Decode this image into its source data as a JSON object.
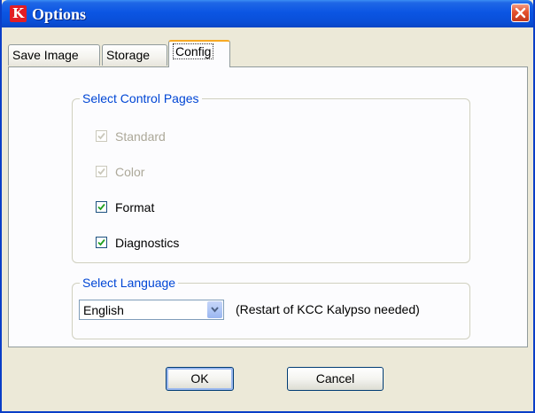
{
  "window": {
    "title": "Options",
    "app_icon_letter": "K",
    "close_glyph": "×"
  },
  "tabs": [
    {
      "label": "Save Image",
      "active": false
    },
    {
      "label": "Storage",
      "active": false
    },
    {
      "label": "Config",
      "active": true
    }
  ],
  "control_pages": {
    "legend": "Select Control Pages",
    "items": [
      {
        "label": "Standard",
        "checked": true,
        "enabled": false
      },
      {
        "label": "Color",
        "checked": true,
        "enabled": false
      },
      {
        "label": "Format",
        "checked": true,
        "enabled": true
      },
      {
        "label": "Diagnostics",
        "checked": true,
        "enabled": true
      }
    ]
  },
  "language": {
    "legend": "Select Language",
    "selected": "English",
    "note": "(Restart of KCC Kalypso needed)"
  },
  "buttons": {
    "ok_label": "OK",
    "cancel_label": "Cancel"
  }
}
